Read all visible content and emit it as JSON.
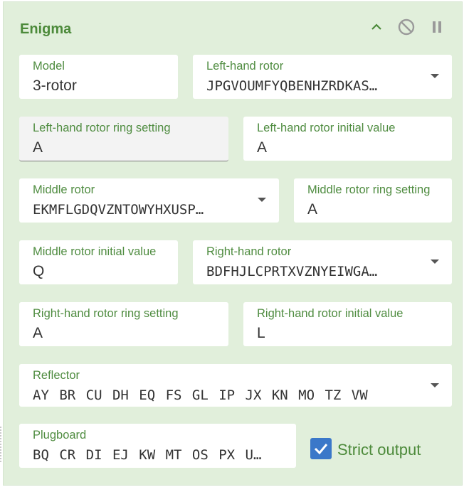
{
  "operation": {
    "title": "Enigma",
    "controls": {
      "collapse_icon": "chevron-up",
      "disable_icon": "circle-slash",
      "breakpoint_icon": "pause"
    }
  },
  "fields": {
    "model": {
      "label": "Model",
      "value": "3-rotor"
    },
    "left_rotor": {
      "label": "Left-hand rotor",
      "value": "JPGVOUMFYQBENHZRDKAS…"
    },
    "left_ring": {
      "label": "Left-hand rotor ring setting",
      "value": "A"
    },
    "left_initial": {
      "label": "Left-hand rotor initial value",
      "value": "A"
    },
    "middle_rotor": {
      "label": "Middle rotor",
      "value": "EKMFLGDQVZNTOWYHXUSP…"
    },
    "middle_ring": {
      "label": "Middle rotor ring setting",
      "value": "A"
    },
    "middle_initial": {
      "label": "Middle rotor initial value",
      "value": "Q"
    },
    "right_rotor": {
      "label": "Right-hand rotor",
      "value": "BDFHJLCPRTXVZNYEIWGA…"
    },
    "right_ring": {
      "label": "Right-hand rotor ring setting",
      "value": "A"
    },
    "right_initial": {
      "label": "Right-hand rotor initial value",
      "value": "L"
    },
    "reflector": {
      "label": "Reflector",
      "value": "AY BR CU DH EQ FS GL IP JX KN MO TZ VW"
    },
    "plugboard": {
      "label": "Plugboard",
      "value": "BQ CR DI EJ KW MT OS PX U…"
    }
  },
  "strict_output": {
    "label": "Strict output",
    "checked": true
  },
  "colors": {
    "panel_bg": "#e1efdb",
    "accent_green": "#4c8a3a",
    "checkbox_blue": "#3b78c9"
  }
}
